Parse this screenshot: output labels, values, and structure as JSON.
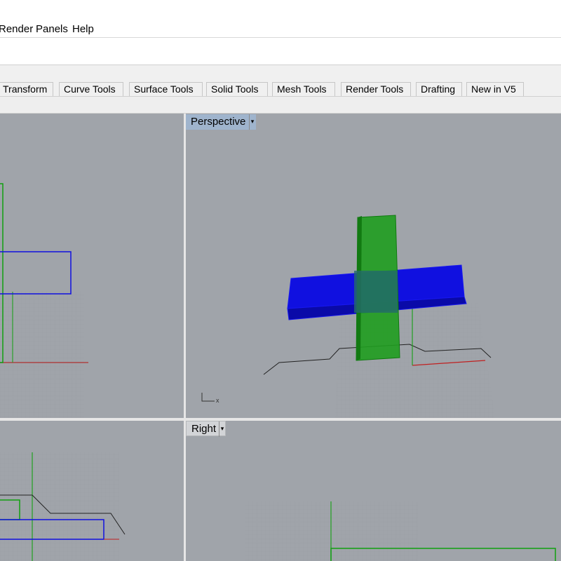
{
  "menu": {
    "items": [
      "Render",
      "Panels",
      "Help"
    ]
  },
  "tabs": [
    "Transform",
    "Curve Tools",
    "Surface Tools",
    "Solid Tools",
    "Mesh Tools",
    "Render Tools",
    "Drafting",
    "New in V5"
  ],
  "viewports": {
    "perspective": {
      "label": "Perspective",
      "axis_label": "x"
    },
    "right": {
      "label": "Right"
    }
  },
  "colors": {
    "viewport_bg": "#a0a4aa",
    "blue_object": "#1010e0",
    "green_object": "#1aa01a",
    "axis_red": "#c02020",
    "axis_green": "#20a020"
  }
}
